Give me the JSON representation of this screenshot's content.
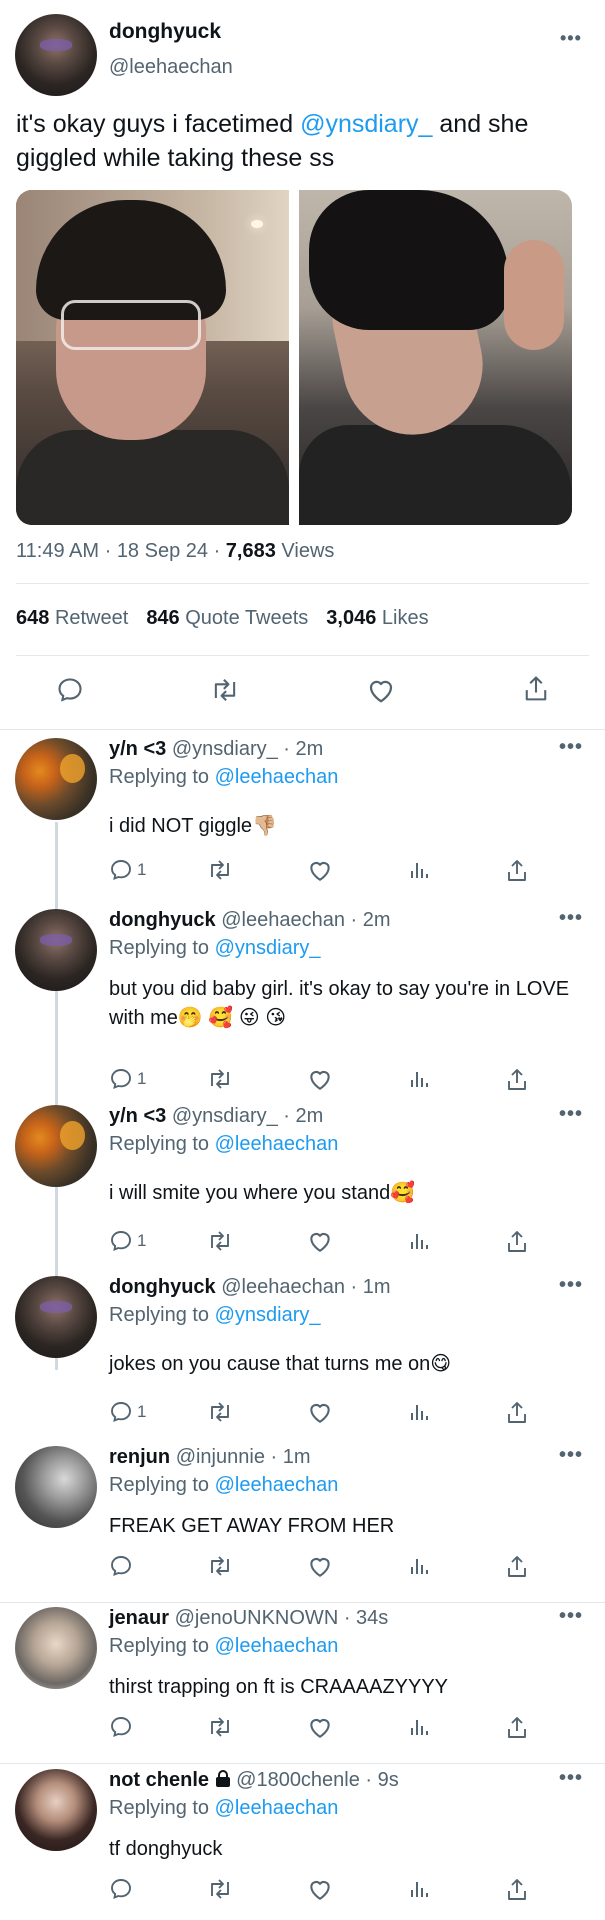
{
  "tweet": {
    "display_name": "donghyuck",
    "handle": "@leehaechan",
    "more": "•••",
    "text_before": "it's okay guys i facetimed ",
    "mention": "@ynsdiary_",
    "text_after": " and she giggled while taking these ss",
    "time": "11:49 AM",
    "date": "18 Sep 24",
    "views_count": "7,683",
    "views_label": "Views",
    "retweets_count": "648",
    "retweets_label": "Retweet",
    "quotes_count": "846",
    "quotes_label": "Quote Tweets",
    "likes_count": "3,046",
    "likes_label": "Likes"
  },
  "actions": [
    "reply-icon",
    "retweet-icon",
    "like-icon",
    "share-icon"
  ],
  "colors": {
    "link": "#1d9bf0",
    "secondary": "#536471",
    "divider": "#e5e8eb"
  },
  "replying_to_label": "Replying to",
  "replies": [
    {
      "name": "y/n <3",
      "handle": "@ynsdiary_",
      "time": "2m",
      "replying_to": "@leehaechan",
      "text": "i did NOT giggle👎🏼",
      "reply_count": "1"
    },
    {
      "name": "donghyuck",
      "handle": "@leehaechan",
      "time": "2m",
      "replying_to": "@ynsdiary_",
      "text": "but you did baby girl. it's okay to say you're in LOVE with me🤭 🥰 😜 😘",
      "reply_count": "1"
    },
    {
      "name": "y/n <3",
      "handle": "@ynsdiary_",
      "time": "2m",
      "replying_to": "@leehaechan",
      "text": "i will smite you where you stand🥰",
      "reply_count": "1"
    },
    {
      "name": "donghyuck",
      "handle": "@leehaechan",
      "time": "1m",
      "replying_to": "@ynsdiary_",
      "text": "jokes on you cause that turns me on😋",
      "reply_count": "1"
    },
    {
      "name": "renjun",
      "handle": "@injunnie",
      "time": "1m",
      "replying_to": "@leehaechan",
      "text": "FREAK GET AWAY FROM HER",
      "reply_count": ""
    },
    {
      "name": "jenaur",
      "handle": "@jenoUNKNOWN",
      "time": "34s",
      "replying_to": "@leehaechan",
      "text": "thirst trapping on ft is CRAAAAZYYYY",
      "reply_count": ""
    },
    {
      "name": "not chenle",
      "name_icon": "lock-icon",
      "handle": "@1800chenle",
      "time": "9s",
      "replying_to": "@leehaechan",
      "text": "tf donghyuck",
      "reply_count": ""
    }
  ]
}
